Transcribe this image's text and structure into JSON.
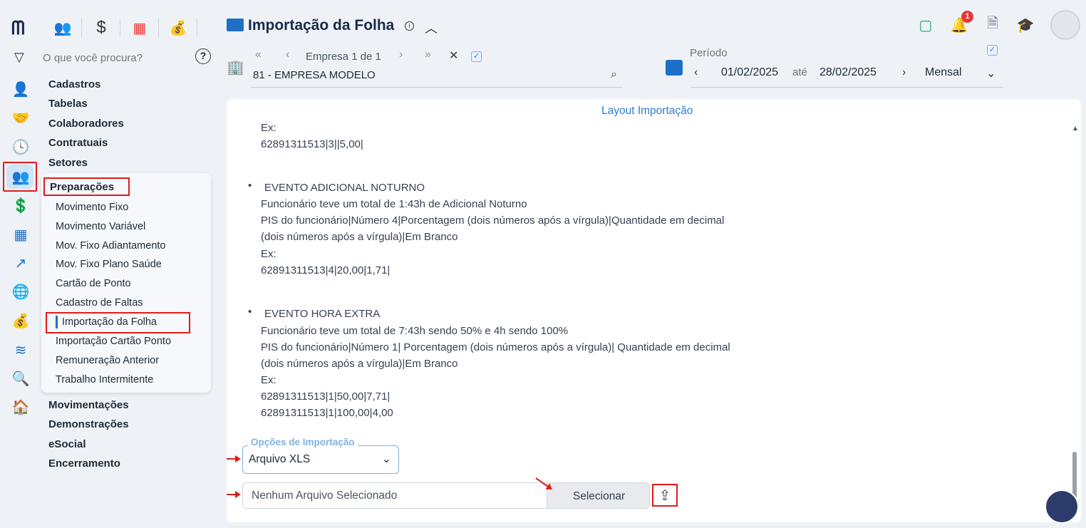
{
  "header": {
    "title": "Importação da Folha",
    "notif_count": "1"
  },
  "search": {
    "placeholder": "O que você procura?"
  },
  "help": "?",
  "menu": {
    "groups_top": [
      "Cadastros",
      "Tabelas",
      "Colaboradores",
      "Contratuais",
      "Setores"
    ],
    "submenu_title": "Preparações",
    "subitems": [
      "Movimento Fixo",
      "Movimento Variável",
      "Mov. Fixo Adiantamento",
      "Mov. Fixo Plano Saúde",
      "Cartão de Ponto",
      "Cadastro de Faltas",
      "Importação da Folha",
      "Importação Cartão Ponto",
      "Remuneração Anterior",
      "Trabalho Intermitente"
    ],
    "groups_bottom": [
      "Movimentações",
      "Demonstrações",
      "eSocial",
      "Encerramento"
    ]
  },
  "empresa": {
    "nav_label": "Empresa 1 de 1",
    "value": "81 - EMPRESA MODELO"
  },
  "periodo": {
    "label": "Período",
    "from": "01/02/2025",
    "sep": "até",
    "to": "28/02/2025",
    "mode": "Mensal"
  },
  "layout": {
    "title": "Layout Importação",
    "top_ex": [
      "Ex:",
      "62891311513|3||5,00|"
    ],
    "events": [
      {
        "name": "EVENTO ADICIONAL NOTURNO",
        "lines": [
          "Funcionário teve um total de 1:43h de Adicional Noturno",
          "PIS do funcionário|Número 4|Porcentagem (dois números após a vírgula)|Quantidade em decimal",
          "(dois números após a vírgula)|Em Branco",
          "Ex:",
          "62891311513|4|20,00|1,71|"
        ]
      },
      {
        "name": "EVENTO HORA EXTRA",
        "lines": [
          "Funcionário teve um total de 7:43h sendo 50% e 4h sendo 100%",
          "PIS do funcionário|Número 1| Porcentagem (dois números após a vírgula)| Quantidade em decimal",
          "(dois números após a vírgula)|Em Branco",
          "Ex:",
          "62891311513|1|50,00|7,71|",
          "62891311513|1|100,00|4,00"
        ]
      }
    ]
  },
  "import": {
    "options_label": "Opções de Importação",
    "option_value": "Arquivo XLS",
    "file_text": "Nenhum Arquivo Selecionado",
    "select_label": "Selecionar"
  }
}
